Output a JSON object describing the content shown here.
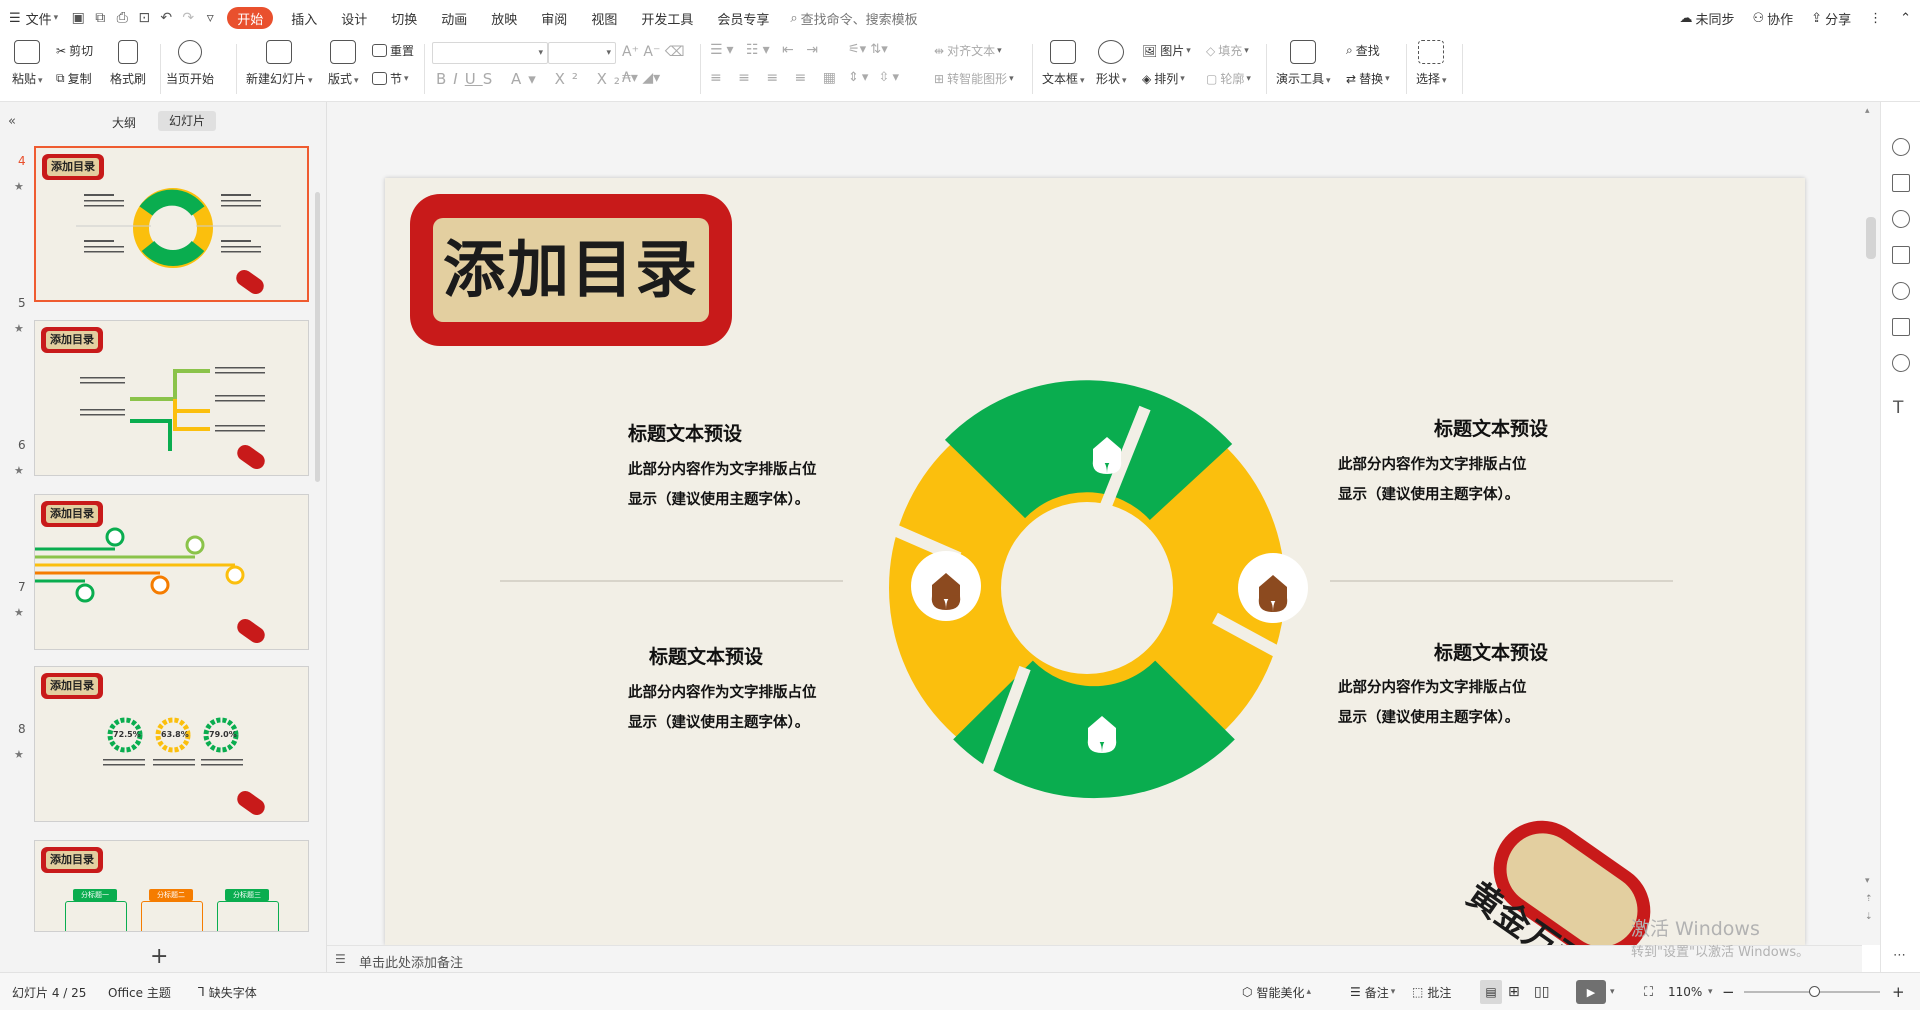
{
  "menubar": {
    "file": "文件",
    "tabs": [
      "开始",
      "插入",
      "设计",
      "切换",
      "动画",
      "放映",
      "审阅",
      "视图",
      "开发工具",
      "会员专享"
    ],
    "search_placeholder": "查找命令、搜索模板",
    "sync": "未同步",
    "collab": "协作",
    "share": "分享"
  },
  "ribbon": {
    "paste": "粘贴",
    "cut": "剪切",
    "copy": "复制",
    "format_painter": "格式刷",
    "from_start": "当页开始",
    "new_slide": "新建幻灯片",
    "layout": "版式",
    "reset": "重置",
    "section": "节",
    "align_text": "对齐文本",
    "smartart": "转智能图形",
    "textbox": "文本框",
    "shape": "形状",
    "picture": "图片",
    "arrange": "排列",
    "fill": "填充",
    "outline": "轮廓",
    "present_tools": "演示工具",
    "find": "查找",
    "replace": "替换",
    "select": "选择"
  },
  "leftpane": {
    "tab_outline": "大纲",
    "tab_slides": "幻灯片",
    "thumb_title": "添加目录",
    "slide_numbers": [
      "4",
      "5",
      "6",
      "7",
      "8"
    ],
    "t7_values": [
      "72.5%",
      "63.8%",
      "79.0%"
    ],
    "t8_headers": [
      "分标题一",
      "分标题二",
      "分标题三"
    ]
  },
  "slide": {
    "title": "添加目录",
    "blocks": [
      {
        "heading": "标题文本预设",
        "line1": "此部分内容作为文字排版占位",
        "line2": "显示（建议使用主题字体）。"
      },
      {
        "heading": "标题文本预设",
        "line1": "此部分内容作为文字排版占位",
        "line2": "显示（建议使用主题字体）。"
      },
      {
        "heading": "标题文本预设",
        "line1": "此部分内容作为文字排版占位",
        "line2": "显示（建议使用主题字体）。"
      },
      {
        "heading": "标题文本预设",
        "line1": "此部分内容作为文字排版占位",
        "line2": "显示（建议使用主题字体）。"
      }
    ],
    "stamp": "黄金万两",
    "colors": {
      "green": "#0aad4f",
      "yellow": "#fbbf0d",
      "red": "#c81a1a",
      "parchment": "#e3cfa0",
      "bg": "#f2efe6",
      "brown": "#8c4a1f"
    }
  },
  "notes": {
    "placeholder": "单击此处添加备注"
  },
  "watermark": {
    "line1": "激活 Windows",
    "line2": "转到\"设置\"以激活 Windows。"
  },
  "status": {
    "slide_count": "幻灯片 4 / 25",
    "theme": "Office 主题",
    "missing_font": "缺失字体",
    "beautify": "智能美化",
    "notes": "备注",
    "comments": "批注",
    "zoom": "110%"
  }
}
